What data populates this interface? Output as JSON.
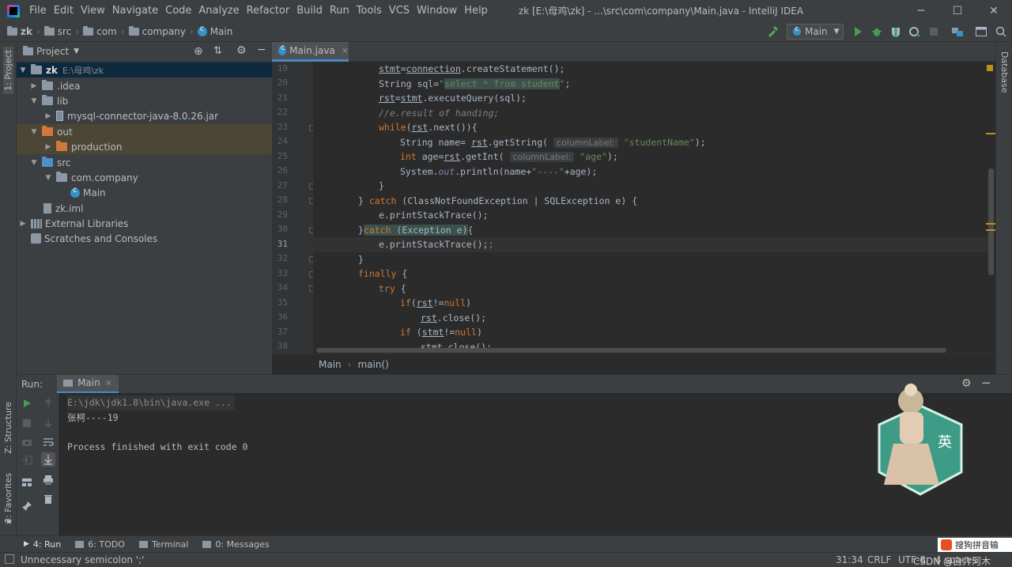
{
  "window": {
    "title": "zk [E:\\母鸡\\zk] - ...\\src\\com\\company\\Main.java - IntelliJ IDEA",
    "menu": [
      "File",
      "Edit",
      "View",
      "Navigate",
      "Code",
      "Analyze",
      "Refactor",
      "Build",
      "Run",
      "Tools",
      "VCS",
      "Window",
      "Help"
    ]
  },
  "navbar": {
    "crumbs": [
      "zk",
      "src",
      "com",
      "company",
      "Main"
    ],
    "run_config": "Main"
  },
  "stripes": {
    "left_top": "1: Project",
    "left_mid": "Z: Structure",
    "left_bottom": "2: Favorites",
    "right": "Database"
  },
  "project": {
    "title": "Project",
    "root": {
      "name": "zk",
      "path": "E:\\母鸡\\zk"
    },
    "items": [
      {
        "label": ".idea"
      },
      {
        "label": "lib"
      },
      {
        "label": "mysql-connector-java-8.0.26.jar"
      },
      {
        "label": "out"
      },
      {
        "label": "production"
      },
      {
        "label": "src"
      },
      {
        "label": "com.company"
      },
      {
        "label": "Main"
      },
      {
        "label": "zk.iml"
      },
      {
        "label": "External Libraries"
      },
      {
        "label": "Scratches and Consoles"
      }
    ]
  },
  "editor": {
    "tab": "Main.java",
    "line_numbers": [
      "19",
      "20",
      "21",
      "22",
      "23",
      "24",
      "25",
      "26",
      "27",
      "28",
      "29",
      "30",
      "31",
      "32",
      "33",
      "34",
      "35",
      "36",
      "37",
      "38"
    ],
    "hint_column_label": "columnLabel:",
    "breadcrumb": [
      "Main",
      "main()"
    ]
  },
  "run": {
    "label": "Run:",
    "tab": "Main",
    "console": [
      "E:\\jdk\\jdk1.8\\bin\\java.exe ...",
      "张柯----19",
      "",
      "Process finished with exit code 0"
    ]
  },
  "tool_tabs": [
    {
      "label": "4: Run"
    },
    {
      "label": "6: TODO"
    },
    {
      "label": "Terminal"
    },
    {
      "label": "0: Messages"
    }
  ],
  "status": {
    "message": "Unnecessary semicolon ';'",
    "position": "31:34",
    "line_sep": "CRLF",
    "encoding": "UTF-8",
    "indent": "4 spaces",
    "watermark": "CSDN @白介河木",
    "ime": "搜狗拼音输"
  },
  "colors": {
    "accent": "#4a88c7",
    "keyword": "#cc7832",
    "string": "#6a8759"
  }
}
